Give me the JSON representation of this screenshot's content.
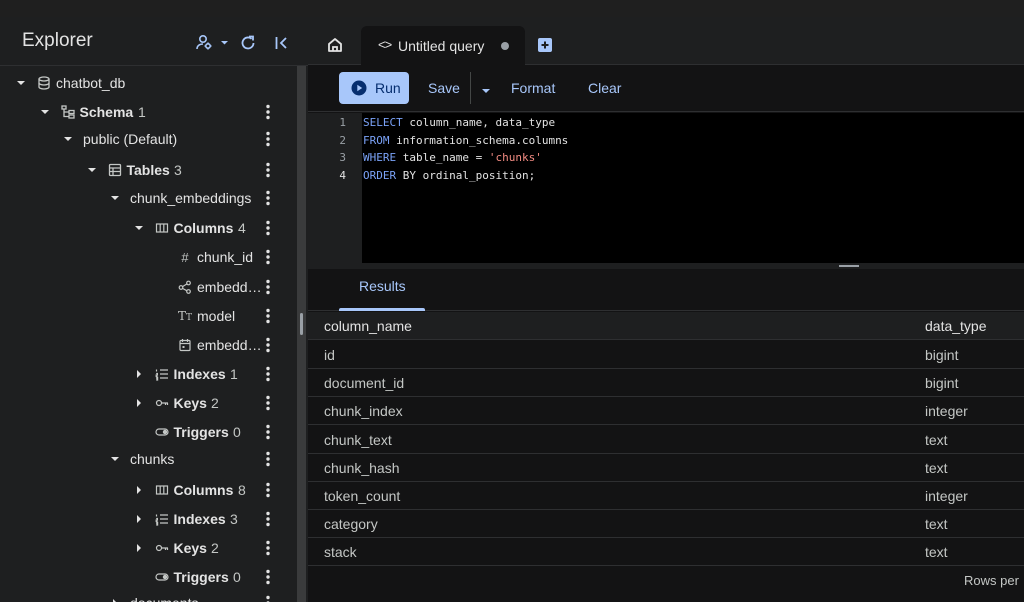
{
  "explorer": {
    "title": "Explorer"
  },
  "tree": [
    {
      "label": "chatbot_db",
      "count": "",
      "icon": "database-icon",
      "bold": false,
      "caret": "down",
      "kebab": false
    },
    {
      "label": "Schema",
      "count": "1",
      "icon": "schema-icon",
      "bold": true,
      "caret": "down",
      "kebab": true
    },
    {
      "label": "public (Default)",
      "count": "",
      "icon": "",
      "bold": false,
      "caret": "down",
      "kebab": true
    },
    {
      "label": "Tables",
      "count": "3",
      "icon": "table-icon",
      "bold": true,
      "caret": "down",
      "kebab": true
    },
    {
      "label": "chunk_embeddings",
      "count": "",
      "icon": "",
      "bold": false,
      "caret": "down",
      "kebab": true
    },
    {
      "label": "Columns",
      "count": "4",
      "icon": "columns-icon",
      "bold": true,
      "caret": "down",
      "kebab": true
    },
    {
      "label": "chunk_id",
      "count": "",
      "icon": "hash-icon",
      "bold": false,
      "caret": "",
      "kebab": true
    },
    {
      "label": "embedd…",
      "count": "",
      "icon": "vector-icon",
      "bold": false,
      "caret": "",
      "kebab": true
    },
    {
      "label": "model",
      "count": "",
      "icon": "text-type-icon",
      "bold": false,
      "caret": "",
      "kebab": true
    },
    {
      "label": "embedd…",
      "count": "",
      "icon": "calendar-icon",
      "bold": false,
      "caret": "",
      "kebab": true
    },
    {
      "label": "Indexes",
      "count": "1",
      "icon": "index-icon",
      "bold": true,
      "caret": "right",
      "kebab": true
    },
    {
      "label": "Keys",
      "count": "2",
      "icon": "key-icon",
      "bold": true,
      "caret": "right",
      "kebab": true
    },
    {
      "label": "Triggers",
      "count": "0",
      "icon": "toggle-icon",
      "bold": true,
      "caret": "",
      "kebab": true
    },
    {
      "label": "chunks",
      "count": "",
      "icon": "",
      "bold": false,
      "caret": "down",
      "kebab": true
    },
    {
      "label": "Columns",
      "count": "8",
      "icon": "columns-icon",
      "bold": true,
      "caret": "right",
      "kebab": true
    },
    {
      "label": "Indexes",
      "count": "3",
      "icon": "index-icon",
      "bold": true,
      "caret": "right",
      "kebab": true
    },
    {
      "label": "Keys",
      "count": "2",
      "icon": "key-icon",
      "bold": true,
      "caret": "right",
      "kebab": true
    },
    {
      "label": "Triggers",
      "count": "0",
      "icon": "toggle-icon",
      "bold": true,
      "caret": "",
      "kebab": true
    },
    {
      "label": "documents",
      "count": "",
      "icon": "",
      "bold": false,
      "caret": "right",
      "kebab": true
    }
  ],
  "tab": {
    "code_glyph": "<>",
    "label": "Untitled query"
  },
  "toolbar": {
    "run": "Run",
    "save": "Save",
    "format": "Format",
    "clear": "Clear"
  },
  "editor": {
    "line_numbers": [
      "1",
      "2",
      "3",
      "4"
    ],
    "lines": [
      [
        {
          "t": "SELECT",
          "k": "kw"
        },
        {
          "t": " column_name, data_type",
          "k": ""
        }
      ],
      [
        {
          "t": "FROM",
          "k": "kw"
        },
        {
          "t": " information_schema.columns",
          "k": ""
        }
      ],
      [
        {
          "t": "WHERE",
          "k": "kw"
        },
        {
          "t": " table_name = ",
          "k": ""
        },
        {
          "t": "'chunks'",
          "k": "str"
        }
      ],
      [
        {
          "t": "ORDER",
          "k": "kw"
        },
        {
          "t": " BY ordinal_position;",
          "k": ""
        }
      ]
    ]
  },
  "results": {
    "tab_label": "Results",
    "columns": [
      "column_name",
      "data_type"
    ],
    "rows": [
      [
        "id",
        "bigint"
      ],
      [
        "document_id",
        "bigint"
      ],
      [
        "chunk_index",
        "integer"
      ],
      [
        "chunk_text",
        "text"
      ],
      [
        "chunk_hash",
        "text"
      ],
      [
        "token_count",
        "integer"
      ],
      [
        "category",
        "text"
      ],
      [
        "stack",
        "text"
      ]
    ],
    "footer": "Rows per"
  },
  "colors": {
    "accent": "#a8c7fa",
    "keyword": "#7aa2f7",
    "string": "#f28b82",
    "background": "#131314",
    "panel": "#1e1f20"
  }
}
